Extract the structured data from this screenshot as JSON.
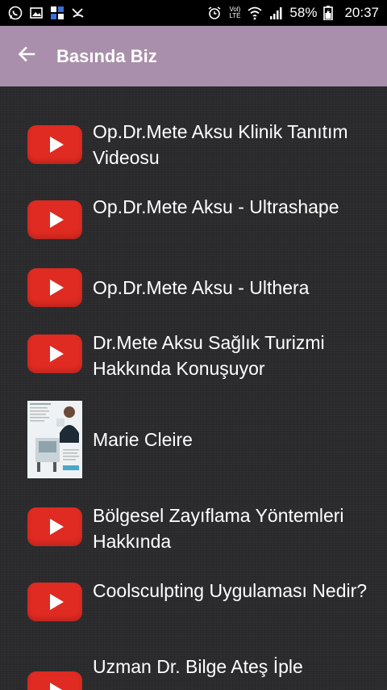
{
  "status_bar": {
    "battery": "58%",
    "time": "20:37",
    "volte_top": "Vol)",
    "volte_bottom": "LTE"
  },
  "app_bar": {
    "title": "Basında Biz"
  },
  "items": [
    {
      "label": "Op.Dr.Mete Aksu Klinik Tanıtım Videosu",
      "type": "youtube"
    },
    {
      "label": "Op.Dr.Mete Aksu - Ultrashape",
      "type": "youtube"
    },
    {
      "label": "Op.Dr.Mete Aksu - Ulthera",
      "type": "youtube"
    },
    {
      "label": "Dr.Mete Aksu Sağlık Turizmi Hakkında Konuşuyor",
      "type": "youtube"
    },
    {
      "label": "Marie Cleire",
      "type": "magazine"
    },
    {
      "label": "Bölgesel Zayıflama Yöntemleri Hakkında",
      "type": "youtube"
    },
    {
      "label": "Coolsculpting Uygulaması Nedir?",
      "type": "youtube"
    },
    {
      "label": "Uzman Dr. Bilge Ateş İple",
      "type": "youtube"
    }
  ],
  "colors": {
    "app_bar": "#a98fab",
    "background": "#2b2b2d",
    "youtube_red": "#e02b22"
  },
  "icons": [
    "whatsapp-icon",
    "gallery-icon",
    "sim-icon",
    "missed-call-icon",
    "alarm-icon",
    "wifi-icon",
    "signal-icon",
    "battery-icon",
    "back-arrow-icon",
    "youtube-icon"
  ]
}
